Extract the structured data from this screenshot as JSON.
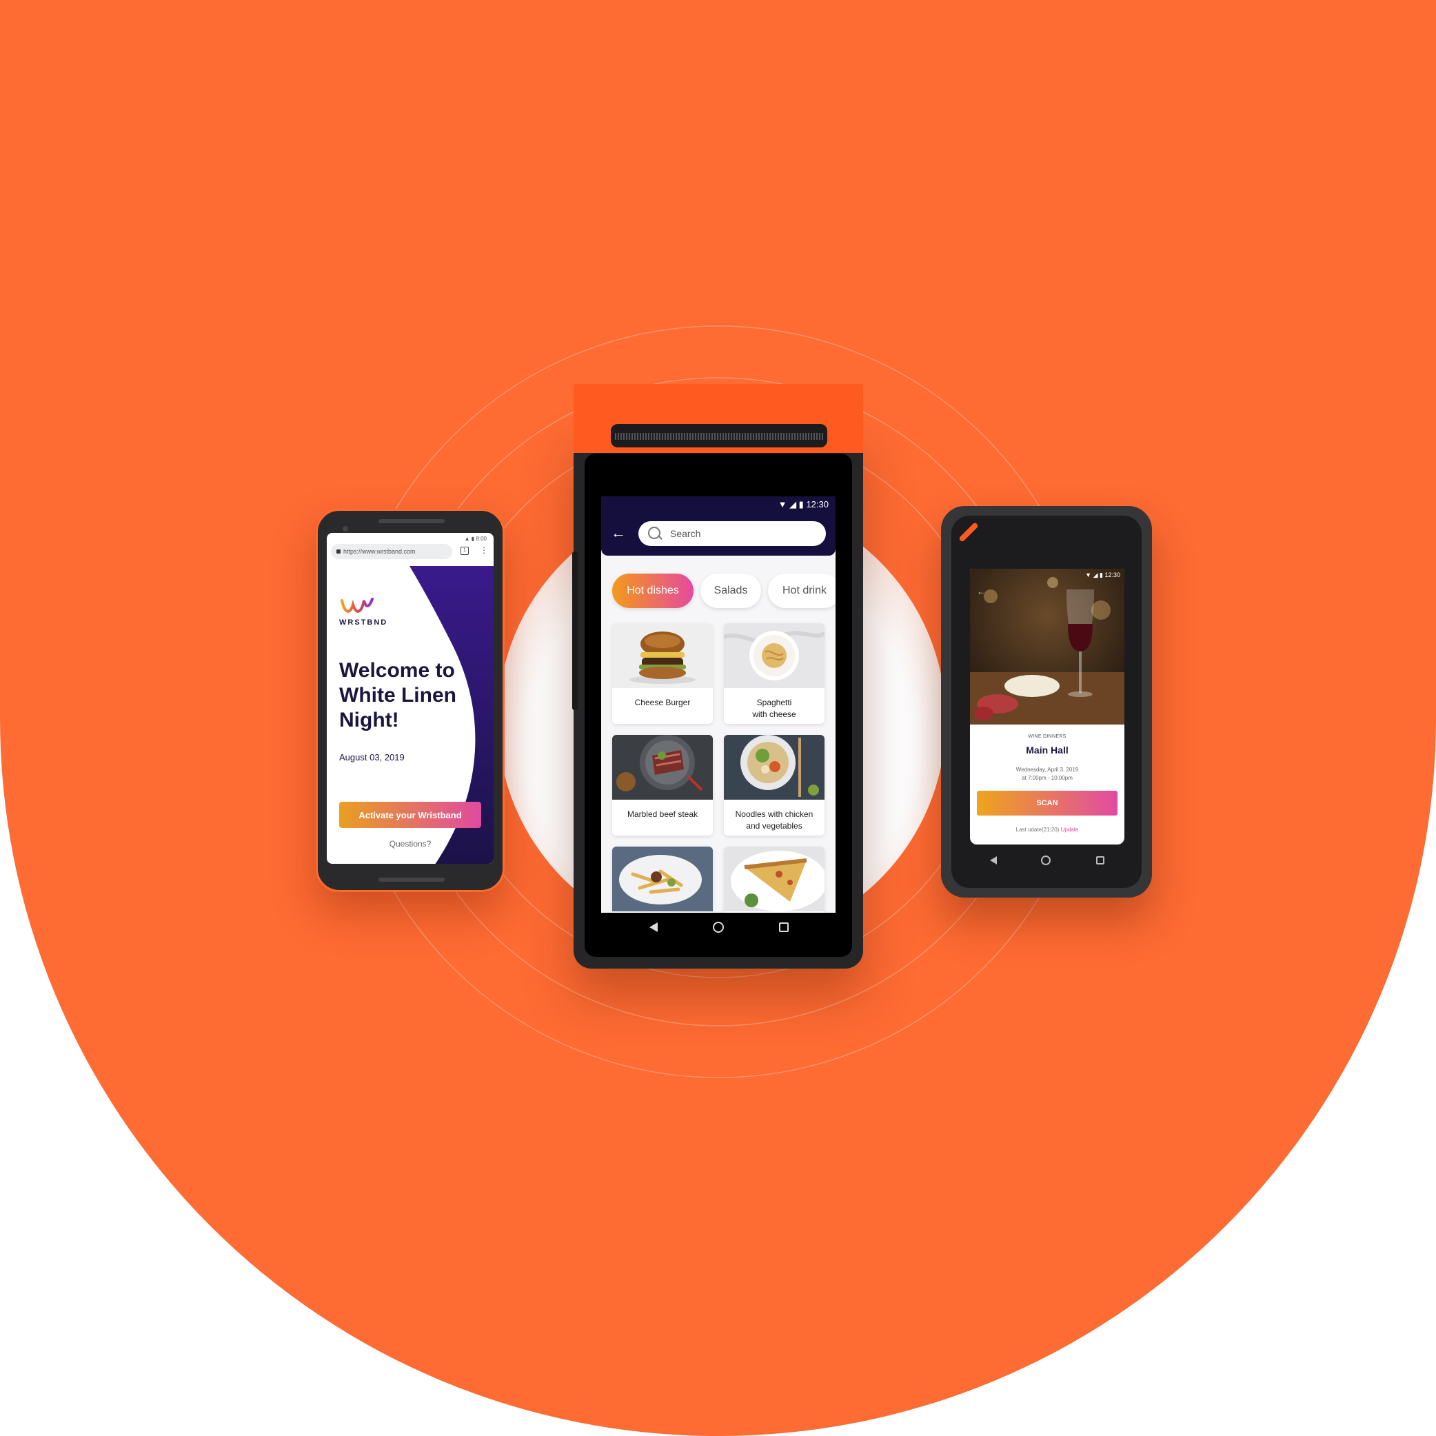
{
  "colors": {
    "background": "#fe6b33",
    "accent_gradient_start": "#f39a1a",
    "accent_gradient_end": "#e44a9e",
    "header_navy": "#140f3d"
  },
  "left_phone": {
    "status_time": "8:00",
    "url": "https://www.wrstband.com",
    "tab_count": "1",
    "brand": "WRSTBND",
    "title": "Welcome to\nWhite Linen\nNight!",
    "date": "August 03, 2019",
    "button": "Activate your Wristband",
    "questions": "Questions?"
  },
  "center_device": {
    "status_time": "12:30",
    "search_placeholder": "Search",
    "tabs": [
      {
        "label": "Hot dishes",
        "active": true
      },
      {
        "label": "Salads",
        "active": false
      },
      {
        "label": "Hot drink",
        "active": false
      }
    ],
    "items": [
      {
        "label": "Cheese Burger",
        "image": "burger-photo"
      },
      {
        "label": "Spaghetti\nwith cheese",
        "image": "pasta-photo"
      },
      {
        "label": "Marbled beef steak",
        "image": "steak-photo"
      },
      {
        "label": "Noodles with chicken\nand vegetables",
        "image": "noodles-photo"
      },
      {
        "label": "",
        "image": "fries-photo"
      },
      {
        "label": "",
        "image": "pizza-photo"
      }
    ]
  },
  "right_device": {
    "status_time": "12:30",
    "category": "WINE DINNERS",
    "title": "Main Hall",
    "date": "Wednesday, April 3, 2019\nat 7:00pm - 10:00pm",
    "scan_button": "SCAN",
    "last_update": "Last udate(21:20)",
    "update_link": "Update"
  }
}
